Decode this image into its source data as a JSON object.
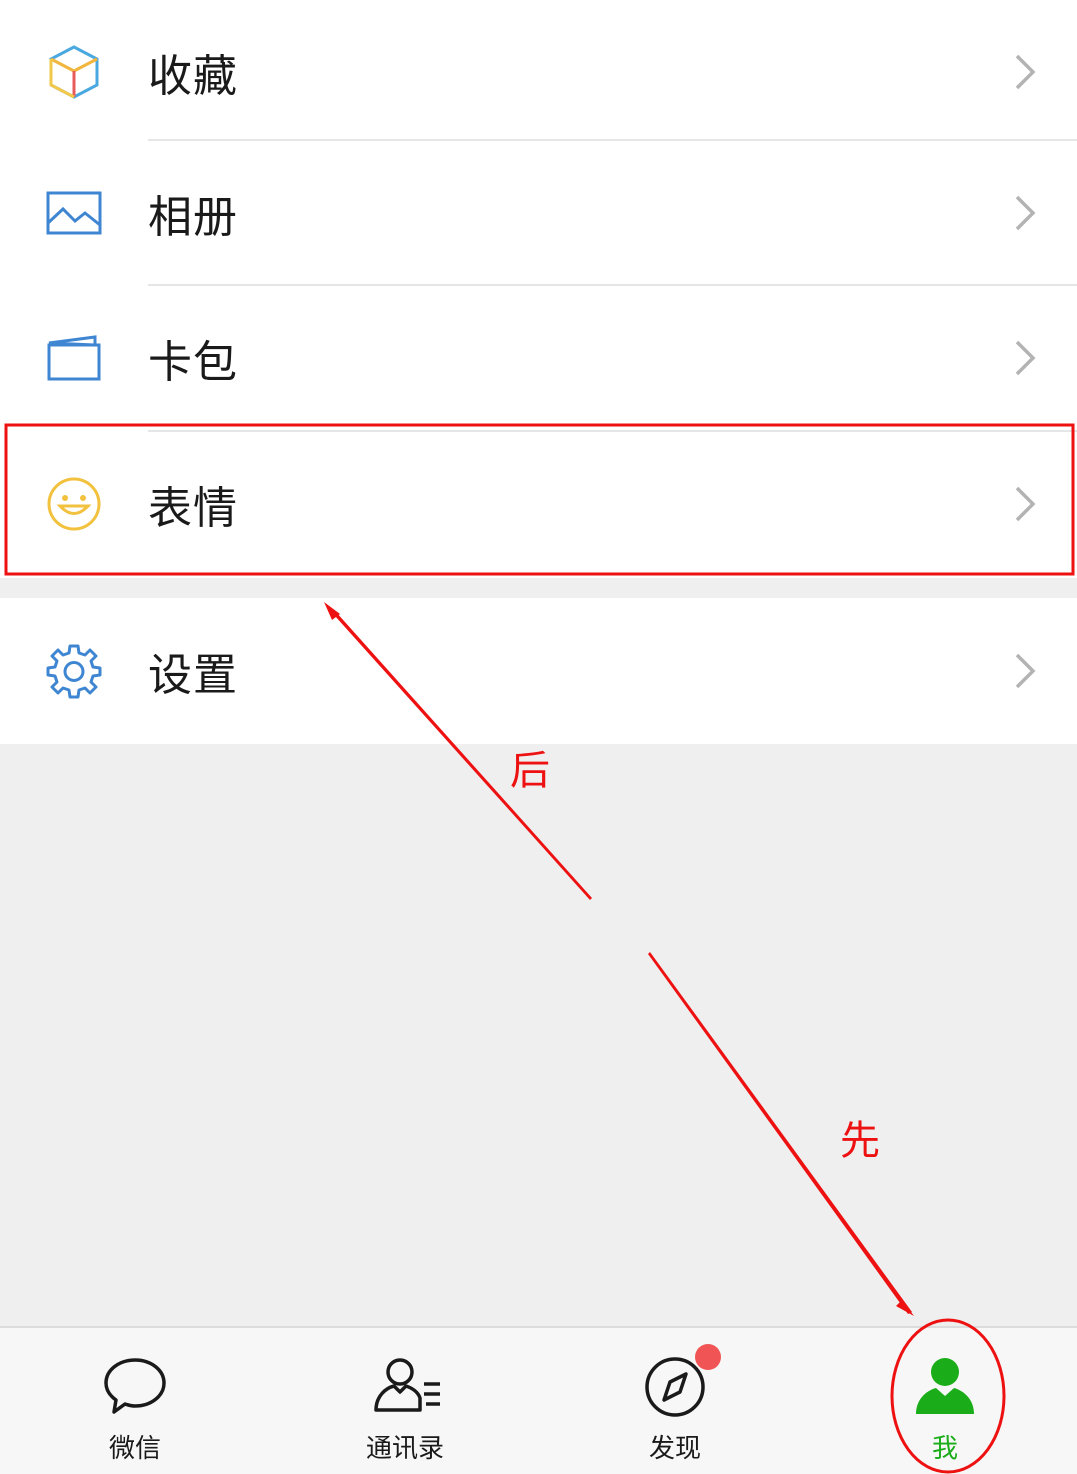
{
  "menu": {
    "items": [
      {
        "label": "收藏",
        "icon": "favorites-cube-icon"
      },
      {
        "label": "相册",
        "icon": "album-picture-icon"
      },
      {
        "label": "卡包",
        "icon": "card-wallet-icon"
      },
      {
        "label": "表情",
        "icon": "smiley-emoji-icon"
      }
    ],
    "settings": {
      "label": "设置",
      "icon": "gear-icon"
    }
  },
  "tabbar": {
    "tabs": [
      {
        "label": "微信",
        "icon": "chat-bubble-icon"
      },
      {
        "label": "通讯录",
        "icon": "contacts-icon"
      },
      {
        "label": "发现",
        "icon": "compass-icon",
        "badge": true
      },
      {
        "label": "我",
        "icon": "person-icon",
        "active": true
      }
    ]
  },
  "annotations": {
    "first_label": "先",
    "second_label": "后",
    "color": "#ee1111"
  },
  "colors": {
    "accent_green": "#1aad19",
    "badge_red": "#f05454"
  }
}
